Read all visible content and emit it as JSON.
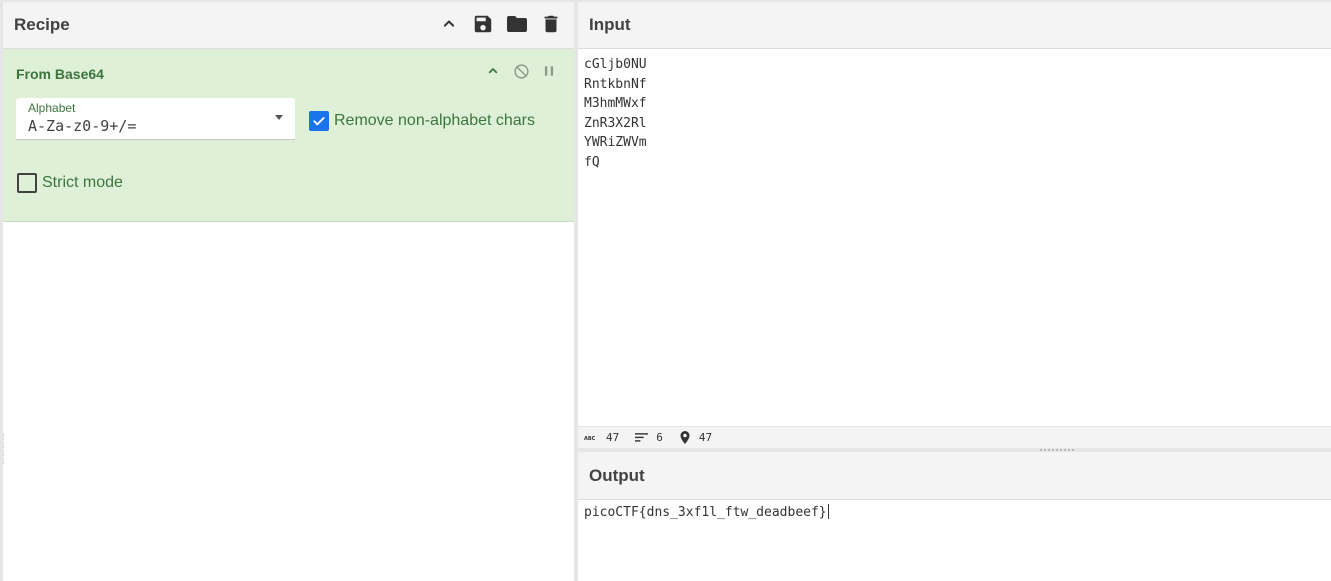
{
  "recipe": {
    "title": "Recipe",
    "header_icons": [
      "chevron-up-icon",
      "save-icon",
      "folder-icon",
      "trash-icon"
    ]
  },
  "operation": {
    "title": "From Base64",
    "alphabet_label": "Alphabet",
    "alphabet_value": "A-Za-z0-9+/=",
    "remove_non_alphabet": {
      "label": "Remove non-alphabet chars",
      "checked": true
    },
    "strict_mode": {
      "label": "Strict mode",
      "checked": false
    },
    "controls": [
      "chevron-up-icon",
      "disable-icon",
      "pause-icon"
    ]
  },
  "input": {
    "title": "Input",
    "lines": [
      "cGljb0NU",
      "RntkbnNf",
      "M3hmMWxf",
      "ZnR3X2Rl",
      "YWRiZWVm",
      "fQ"
    ]
  },
  "status": {
    "length": "47",
    "lines": "6",
    "position": "47"
  },
  "output": {
    "title": "Output",
    "text": "picoCTF{dns_3xf1l_ftw_deadbeef}"
  },
  "colors": {
    "operation_bg": "#dff0d8",
    "operation_text": "#3c763d",
    "checkbox_checked": "#1a73e8"
  }
}
